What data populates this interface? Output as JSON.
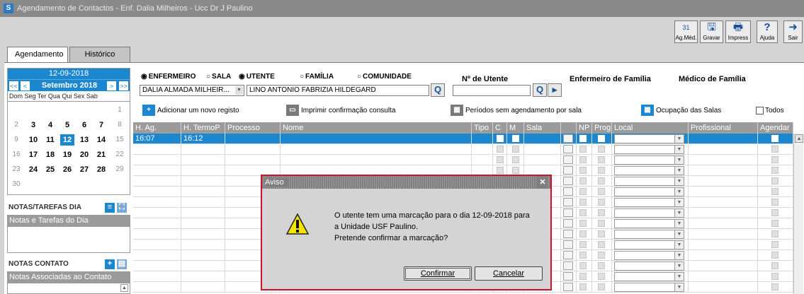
{
  "window": {
    "title": "Agendamento de Contactos - Enf. Dalia Milheiros - Ucc Dr J Paulino",
    "app_icon": "S"
  },
  "toolbar": [
    {
      "label": "Ag.Méd.",
      "icon": "calendar-icon",
      "glyph": "31"
    },
    {
      "label": "Gravar",
      "icon": "save-icon",
      "glyph": "🖫"
    },
    {
      "label": "Impress",
      "icon": "printer-icon",
      "glyph": "🖶"
    },
    {
      "label": "Ajuda",
      "icon": "help-icon",
      "glyph": "?"
    },
    {
      "label": "Sair",
      "icon": "exit-icon",
      "glyph": "➜"
    }
  ],
  "tabs": [
    {
      "label": "Agendamento",
      "active": true
    },
    {
      "label": "Histórico",
      "active": false
    }
  ],
  "calendar": {
    "date": "12-09-2018",
    "month": "Setembro 2018",
    "nav": {
      "first": "<<",
      "prev": "<",
      "next": ">",
      "last": ">>"
    },
    "weekdays": "Dom Seg Ter Qua Qui Sex Sab",
    "weeks": [
      [
        "",
        "",
        "",
        "",
        "",
        "",
        "1"
      ],
      [
        "2",
        "3",
        "4",
        "5",
        "6",
        "7",
        "8"
      ],
      [
        "9",
        "10",
        "11",
        "12",
        "13",
        "14",
        "15"
      ],
      [
        "16",
        "17",
        "18",
        "19",
        "20",
        "21",
        "22"
      ],
      [
        "23",
        "24",
        "25",
        "26",
        "27",
        "28",
        "29"
      ],
      [
        "30",
        "",
        "",
        "",
        "",
        "",
        ""
      ]
    ],
    "selected": "12"
  },
  "notas_tarefas": {
    "title": "NOTAS/TAREFAS DIA",
    "bar": "Notas e Tarefas do Dia"
  },
  "notas_contato": {
    "title": "NOTAS CONTATO",
    "bar": "Notas Associadas ao Contato"
  },
  "filters": {
    "radios": [
      {
        "label": "ENFERMEIRO",
        "checked": true
      },
      {
        "label": "SALA",
        "checked": false
      },
      {
        "label": "UTENTE",
        "checked": true
      },
      {
        "label": "FAMÍLIA",
        "checked": false
      },
      {
        "label": "COMUNIDADE",
        "checked": false
      }
    ],
    "enfermeiro_value": "DALIA ALMADA MILHEIR...",
    "utente_value": "LINO ANTONIO FABRIZIA HILDEGARD",
    "n_utente_label": "Nº de Utente",
    "n_utente_value": "",
    "enf_familia_label": "Enfermeiro de Família",
    "med_familia_label": "Médico de Família"
  },
  "actions": {
    "add": "Adicionar um novo registo",
    "print": "Imprimir confirmação consulta",
    "periods": "Períodos sem agendamento por sala",
    "rooms": "Ocupação das Salas",
    "todos": "Todos"
  },
  "grid": {
    "headers": [
      "H. Ag.",
      "H. TermoP",
      "Processo",
      "Nome",
      "Tipo",
      "C",
      "M",
      "Sala",
      "",
      "NP",
      "Prog",
      "Local",
      "Profissional",
      "Agendar"
    ],
    "rows": [
      {
        "h_ag": "16:07",
        "h_termo": "16:12",
        "selected": true
      }
    ]
  },
  "dialog": {
    "title": "Aviso",
    "close": "✕",
    "message_lines": [
      "O utente tem uma marcação para o dia 12-09-2018 para",
      "a Unidade USF Paulino.",
      "Pretende confirmar a marcação?"
    ],
    "confirm": "Confirmar",
    "cancel": "Cancelar"
  },
  "colors": {
    "accent": "#1b87cf",
    "dialog_border": "#d0102a",
    "header_grey": "#9b9b9b"
  }
}
